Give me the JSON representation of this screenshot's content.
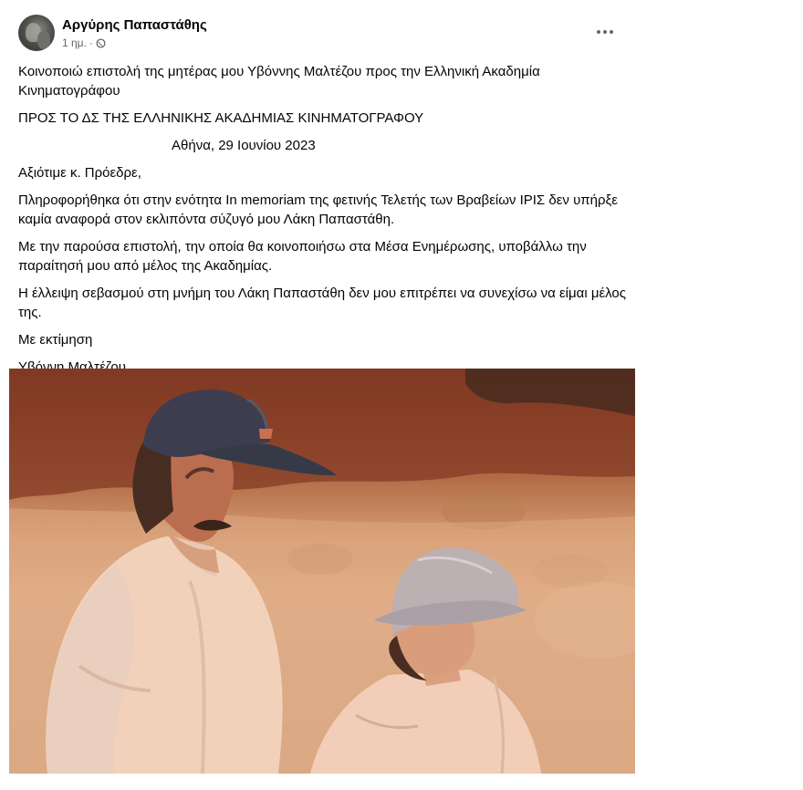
{
  "post": {
    "author": "Αργύρης Παπαστάθης",
    "time": "1 ημ.",
    "separator": "·",
    "more_icon": "more-horizontal-icon",
    "privacy_icon": "globe-icon"
  },
  "content": {
    "intro": "Κοινοποιώ επιστολή της μητέρας μου Υβόννης Μαλτέζου προς την Ελληνική Ακαδημία Κινηματογράφου",
    "heading": "ΠΡΟΣ ΤΟ ΔΣ ΤΗΣ ΕΛΛΗΝΙΚΗΣ ΑΚΑΔΗΜΙΑΣ ΚΙΝΗΜΑΤΟΓΡΑΦΟΥ",
    "date": "Αθήνα, 29 Ιουνίου 2023",
    "salutation": "Αξιότιμε κ. Πρόεδρε,",
    "paragraph1": "Πληροφορήθηκα ότι στην ενότητα In memoriam της φετινής Τελετής των Βραβείων ΙΡΙΣ δεν υπήρξε καμία αναφορά στον εκλιπόντα σύζυγό μου Λάκη Παπαστάθη.",
    "paragraph2": "Με την παρούσα επιστολή, την οποία θα κοινοποιήσω στα Μέσα Ενημέρωσης, υποβάλλω την παραίτησή μου από μέλος της Ακαδημίας.",
    "paragraph3": "Η έλλειψη σεβασμού στη μνήμη του Λάκη Παπαστάθη δεν μου επιτρέπει να συνεχίσω να είμαι μέλος της.",
    "closing": "Με εκτίμηση",
    "signature": "Υβόννη Μαλτέζου"
  },
  "colors": {
    "text": "#050505",
    "secondary": "#65676b",
    "photo_tone": "#d49b72"
  }
}
